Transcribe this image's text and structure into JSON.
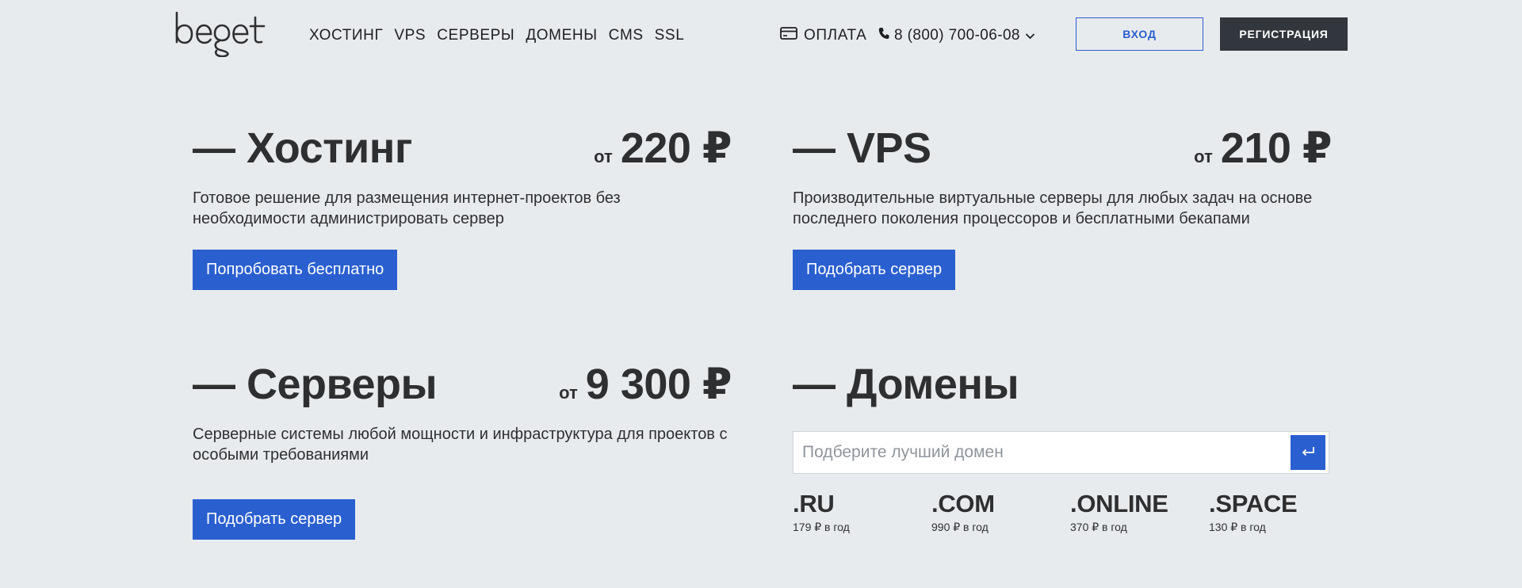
{
  "brand": {
    "logo_text": "beget"
  },
  "nav": {
    "items": [
      {
        "label": "ХОСТИНГ"
      },
      {
        "label": "VPS"
      },
      {
        "label": "СЕРВЕРЫ"
      },
      {
        "label": "ДОМЕНЫ"
      },
      {
        "label": "CMS"
      },
      {
        "label": "SSL"
      }
    ]
  },
  "header": {
    "payment_label": "ОПЛАТА",
    "payment_icon": "credit-card-icon",
    "phone_icon": "phone-icon",
    "phone": "8 (800) 700-06-08",
    "phone_dropdown_icon": "chevron-down-icon",
    "login_label": "ВХОД",
    "register_label": "РЕГИСТРАЦИЯ"
  },
  "products": {
    "hosting": {
      "title": "— Хостинг",
      "price_prefix": "от",
      "price": "220 ₽",
      "description": "Готовое решение для размещения интернет-проектов без необходимости администрировать сервер",
      "cta": "Попробовать бесплатно"
    },
    "vps": {
      "title": "— VPS",
      "price_prefix": "от",
      "price": "210 ₽",
      "description": "Производительные виртуальные серверы для любых задач на основе последнего поколения процессоров и бесплатными бекапами",
      "cta": "Подобрать сервер"
    },
    "servers": {
      "title": "— Серверы",
      "price_prefix": "от",
      "price": "9 300 ₽",
      "description": "Серверные системы любой мощности и инфраструктура для проектов с особыми требованиями",
      "cta": "Подобрать сервер"
    }
  },
  "domains": {
    "title": "— Домены",
    "search_placeholder": "Подберите лучший домен",
    "search_value": "",
    "submit_icon": "enter-arrow-icon",
    "zones": [
      {
        "name": ".RU",
        "price": "179 ₽ в год"
      },
      {
        "name": ".COM",
        "price": "990 ₽ в год"
      },
      {
        "name": ".ONLINE",
        "price": "370 ₽ в год"
      },
      {
        "name": ".SPACE",
        "price": "130 ₽ в год"
      }
    ]
  },
  "colors": {
    "background": "#e8ebee",
    "accent": "#2a5fcf",
    "dark_button": "#32373d",
    "text": "#2e2f31"
  }
}
